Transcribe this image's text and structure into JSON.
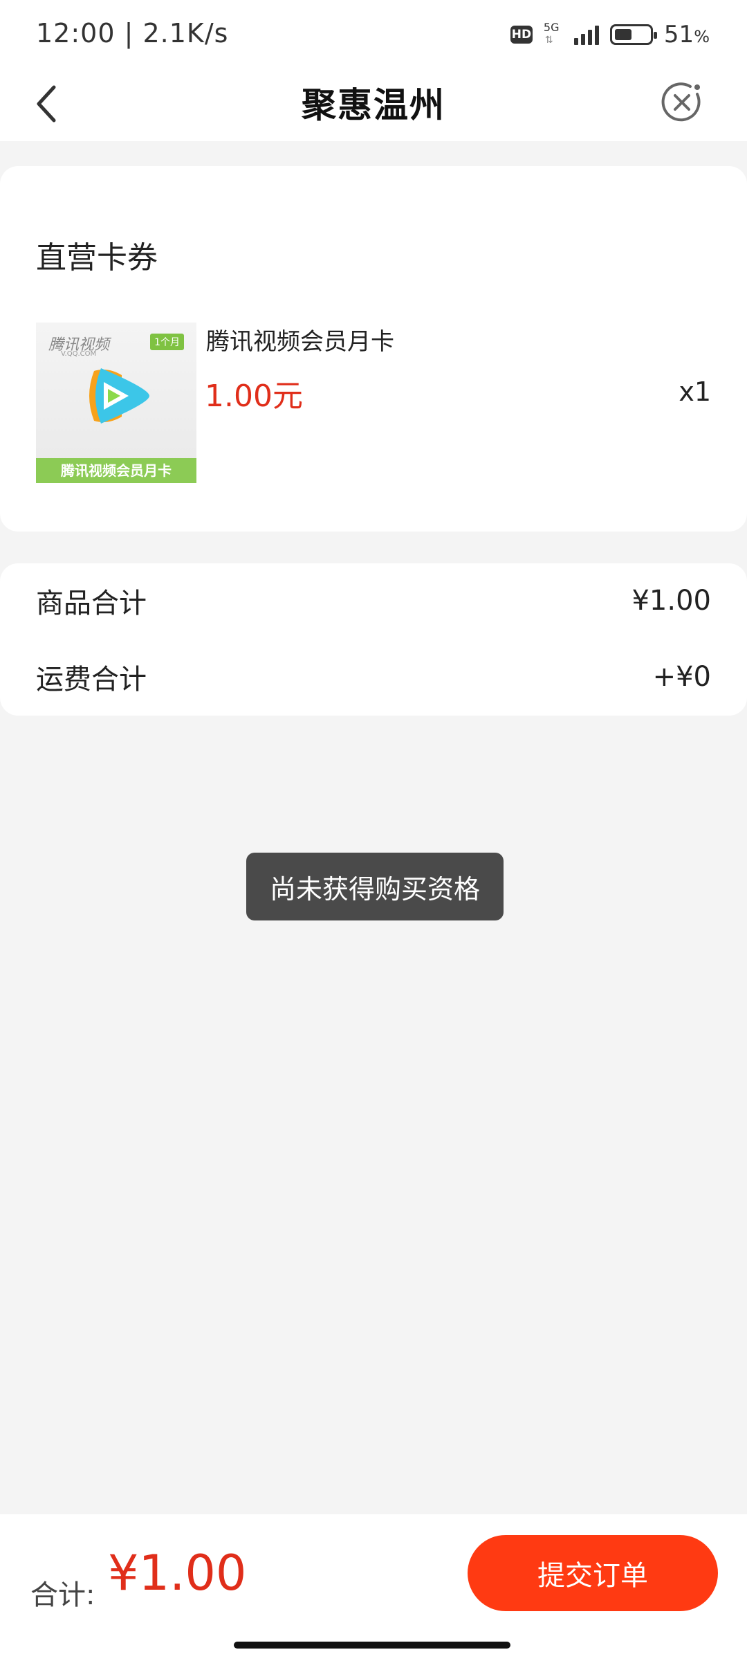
{
  "status_bar": {
    "time": "12:00 | 2.1K/s",
    "hd_label": "HD",
    "network": "5G",
    "battery_percent": "51",
    "battery_unit": "%"
  },
  "nav": {
    "title": "聚惠温州"
  },
  "goods_section": {
    "title": "直营卡券",
    "product": {
      "image_brand": "腾讯视频",
      "image_sub": "V.QQ.COM",
      "image_tag": "1个月",
      "image_banner": "腾讯视频会员月卡",
      "name": "腾讯视频会员月卡",
      "price": "1.00元",
      "quantity": "x1"
    }
  },
  "summary": {
    "goods_total_label": "商品合计",
    "goods_total_value": "¥1.00",
    "shipping_label": "运费合计",
    "shipping_value": "+¥0"
  },
  "toast": {
    "message": "尚未获得购买资格"
  },
  "bottom_bar": {
    "total_label": "合计:",
    "total_value": "¥1.00",
    "submit_label": "提交订单"
  },
  "colors": {
    "accent": "#ff3a12",
    "price": "#e02e1a",
    "background": "#f4f4f4"
  }
}
